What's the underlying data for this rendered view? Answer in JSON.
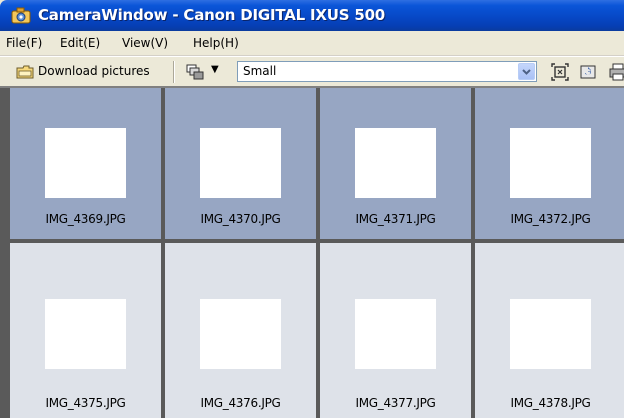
{
  "window": {
    "title": "CameraWindow - Canon DIGITAL IXUS 500"
  },
  "menu": [
    {
      "label": "File(F)"
    },
    {
      "label": "Edit(E)"
    },
    {
      "label": "View(V)"
    },
    {
      "label": "Help(H)"
    }
  ],
  "toolbar": {
    "download_label": "Download pictures",
    "size_selected": "Small",
    "icons": [
      "download-icon",
      "view-toggle-icon",
      "chevron-down-icon",
      "select-all-icon",
      "rotate-icon",
      "print-icon",
      "delete-icon"
    ]
  },
  "thumbnails": [
    {
      "filename": "IMG_4369.JPG",
      "selected": true
    },
    {
      "filename": "IMG_4370.JPG",
      "selected": true
    },
    {
      "filename": "IMG_4371.JPG",
      "selected": true
    },
    {
      "filename": "IMG_4372.JPG",
      "selected": true
    },
    {
      "filename": "IMG_4375.JPG",
      "selected": false
    },
    {
      "filename": "IMG_4376.JPG",
      "selected": false
    },
    {
      "filename": "IMG_4377.JPG",
      "selected": false
    },
    {
      "filename": "IMG_4378.JPG",
      "selected": false
    }
  ],
  "colors": {
    "selected_tile": "#97a6c3",
    "normal_tile": "#dee2e9",
    "titlebar": "#0748c6"
  }
}
